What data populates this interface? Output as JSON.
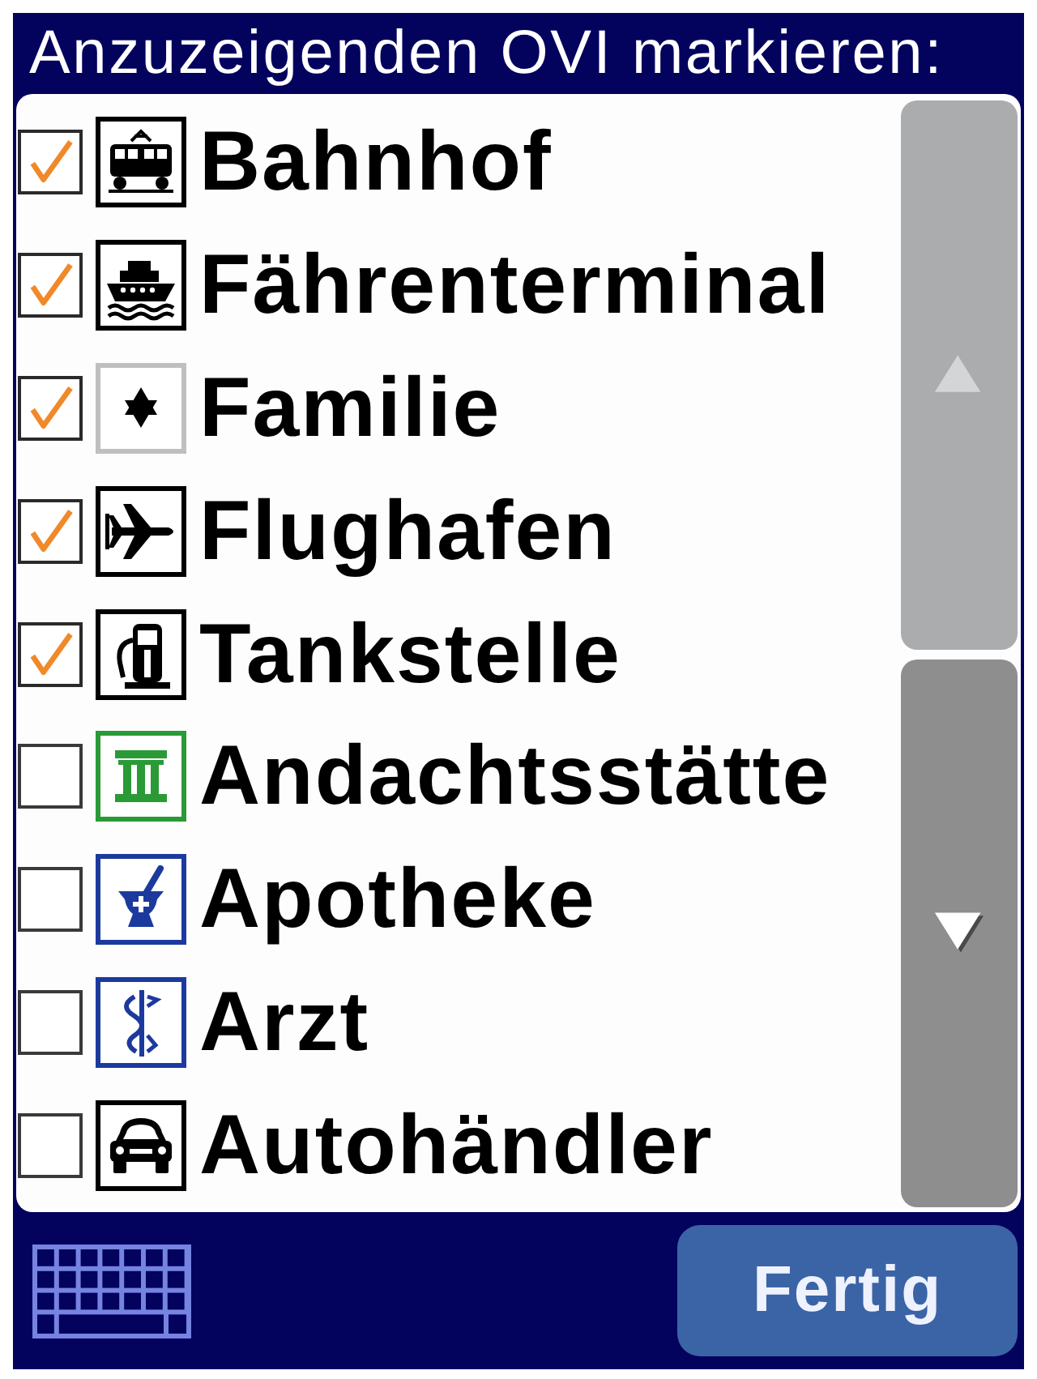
{
  "title": "Anzuzeigenden OVI markieren:",
  "items": [
    {
      "label": "Bahnhof",
      "checked": true,
      "color": "#000000"
    },
    {
      "label": "Fährenterminal",
      "checked": true,
      "color": "#000000"
    },
    {
      "label": "Familie",
      "checked": true,
      "color": "#bfbfbf"
    },
    {
      "label": "Flughafen",
      "checked": true,
      "color": "#000000"
    },
    {
      "label": "Tankstelle",
      "checked": true,
      "color": "#000000"
    },
    {
      "label": "Andachtsstätte",
      "checked": false,
      "color": "#2a9a36"
    },
    {
      "label": "Apotheke",
      "checked": false,
      "color": "#1c3a9e"
    },
    {
      "label": "Arzt",
      "checked": false,
      "color": "#1c3a9e"
    },
    {
      "label": "Autohändler",
      "checked": false,
      "color": "#000000"
    }
  ],
  "scroll_buttons": [
    {
      "kind": "up",
      "disabled": true
    },
    {
      "kind": "down",
      "disabled": false
    }
  ],
  "footer": {
    "done_button": "Fertig"
  }
}
